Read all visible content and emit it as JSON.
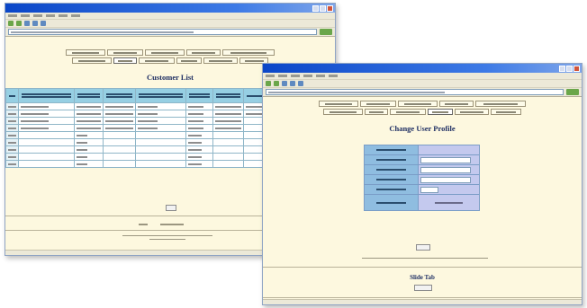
{
  "customer_window": {
    "title": "Customer List",
    "nav_rows": [
      6,
      6
    ],
    "table": {
      "columns": 9,
      "rows": 9,
      "filled_rows": 4
    }
  },
  "profile_window": {
    "title": "Change User Profile",
    "form_fields": 6,
    "section_title": "Slide Tab"
  },
  "colors": {
    "page_bg": "#fdf8df",
    "title_bar": "#0a46c8",
    "table_header": "#96cfe3",
    "form_label_cell": "#8fbde0",
    "form_value_cell": "#c4c9ee",
    "heading_text": "#1f2f63"
  },
  "icons": [
    "window-close-icon",
    "window-maximize-icon",
    "window-minimize-icon",
    "back-icon",
    "forward-icon",
    "go-icon"
  ]
}
